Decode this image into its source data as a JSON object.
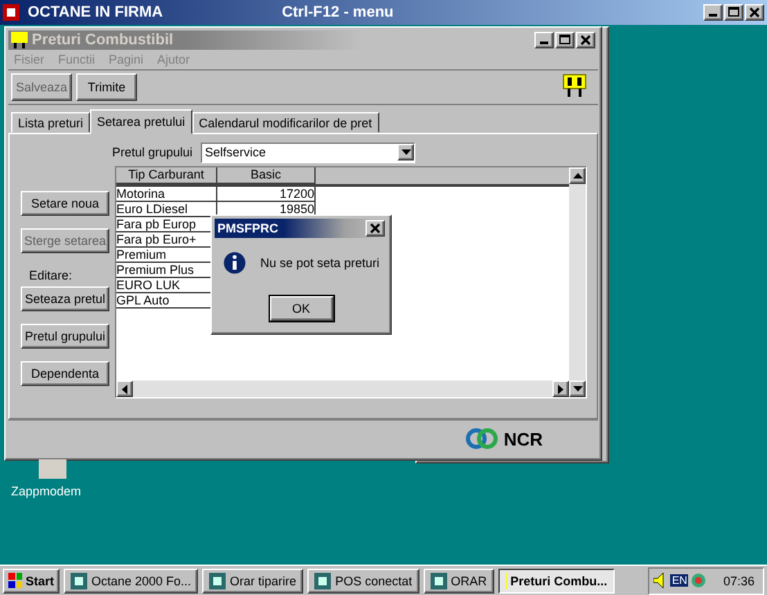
{
  "desktop_window": {
    "title": "OCTANE IN FIRMA",
    "hint": "Ctrl-F12 - menu"
  },
  "window": {
    "title": "Preturi Combustibil",
    "menu": [
      {
        "label": "Fisier",
        "disabled": true
      },
      {
        "label": "Functii",
        "disabled": true
      },
      {
        "label": "Pagini",
        "disabled": true
      },
      {
        "label": "Ajutor",
        "disabled": true
      }
    ],
    "toolbar": [
      {
        "label": "Salveaza",
        "disabled": true
      },
      {
        "label": "Trimite",
        "disabled": false
      }
    ],
    "tabs": [
      {
        "label": "Lista preturi",
        "selected": false
      },
      {
        "label": "Setarea pretului",
        "selected": true
      },
      {
        "label": "Calendarul modificarilor de pret",
        "selected": false
      }
    ],
    "group_price": {
      "label": "Pretul grupului",
      "value": "Selfservice"
    },
    "side_buttons": [
      {
        "kind": "button",
        "label": "Setare noua",
        "disabled": false
      },
      {
        "kind": "button",
        "label": "Sterge setarea",
        "disabled": true
      },
      {
        "kind": "label",
        "label": "Editare:"
      },
      {
        "kind": "button",
        "label": "Seteaza pretul",
        "disabled": false
      },
      {
        "kind": "button",
        "label": "Pretul grupului",
        "disabled": false
      },
      {
        "kind": "button",
        "label": "Dependenta",
        "disabled": false
      }
    ],
    "table": {
      "columns": [
        "Tip Carburant",
        "Basic"
      ],
      "rows": [
        {
          "name": "Motorina",
          "basic": "17200"
        },
        {
          "name": "Euro LDiesel",
          "basic": "19850"
        },
        {
          "name": "Fara pb Europ"
        },
        {
          "name": "Fara pb Euro+"
        },
        {
          "name": "Premium"
        },
        {
          "name": "Premium Plus"
        },
        {
          "name": "EURO LUK"
        },
        {
          "name": "GPL Auto"
        }
      ]
    },
    "brand": "NCR"
  },
  "dialog": {
    "title": "PMSFPRC",
    "message": "Nu se pot seta preturi",
    "button": "OK"
  },
  "desktop_icons": [
    {
      "label": "Zappmodem"
    }
  ],
  "taskbar": {
    "start": "Start",
    "tasks": [
      {
        "label": "Octane 2000 Fo...",
        "selected": false
      },
      {
        "label": "Orar tiparire",
        "selected": false
      },
      {
        "label": "POS conectat",
        "selected": false
      },
      {
        "label": "ORAR",
        "selected": false
      },
      {
        "label": "Preturi Combu...",
        "selected": true
      }
    ],
    "tray": {
      "language": "EN",
      "clock": "07:36"
    }
  }
}
